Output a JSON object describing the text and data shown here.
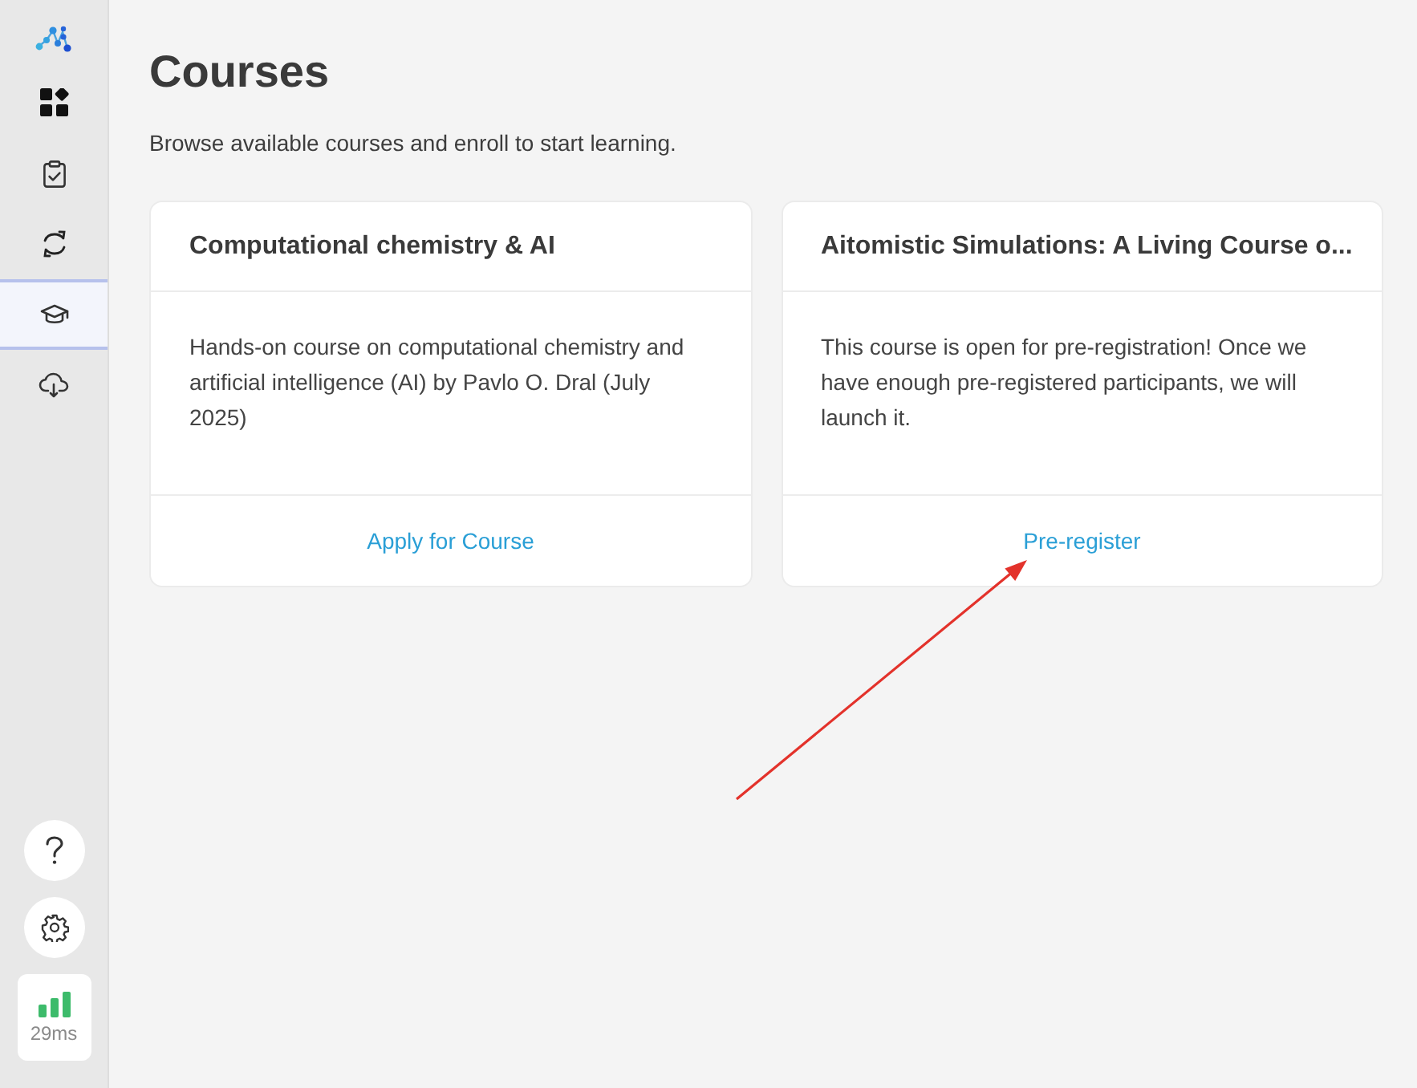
{
  "sidebar": {
    "nav_items": [
      {
        "selected": false
      },
      {
        "selected": false
      },
      {
        "selected": false
      },
      {
        "selected": true
      },
      {
        "selected": false
      }
    ],
    "latency": {
      "reading": "29ms"
    }
  },
  "page": {
    "title": "Courses",
    "subtitle": "Browse available courses and enroll to start learning."
  },
  "courses": [
    {
      "title": "Computational chemistry & AI",
      "description": "Hands-on course on computational chemistry and artificial intelligence (AI) by Pavlo O. Dral (July 2025)",
      "action": "Apply for Course"
    },
    {
      "title": "Aitomistic Simulations: A Living Course o...",
      "description": "This course is open for pre-registration! Once we have enough pre-registered participants, we will launch it.",
      "action": "Pre-register"
    }
  ]
}
